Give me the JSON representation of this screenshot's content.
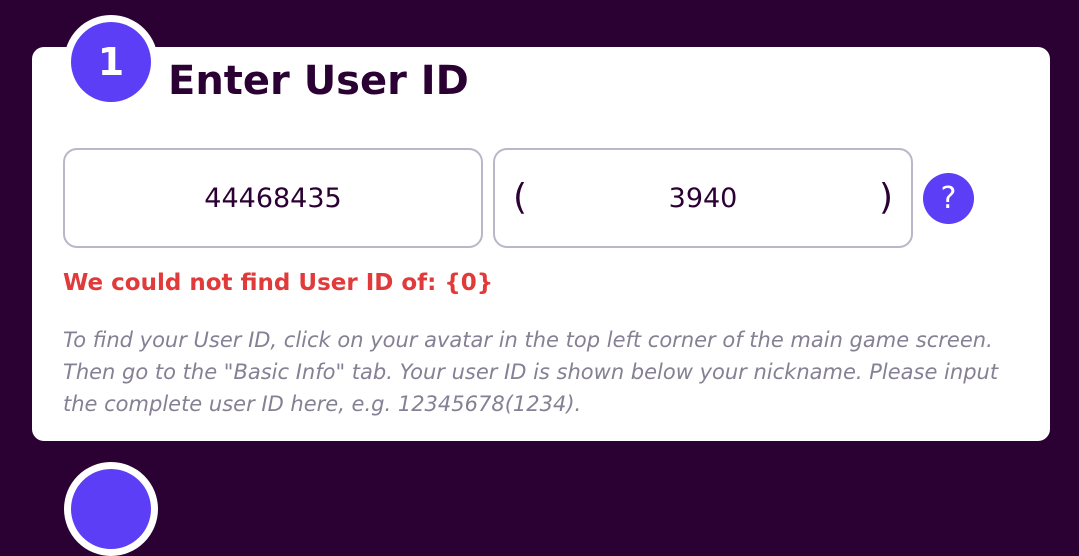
{
  "step": {
    "number": "1",
    "title": "Enter User ID"
  },
  "user_id_input": {
    "value": "44468435"
  },
  "server_input": {
    "open_paren": "(",
    "value": "3940",
    "close_paren": ")"
  },
  "help_button": {
    "label": "?"
  },
  "error": {
    "message": "We could not find User ID of: {0}"
  },
  "instructions": {
    "text": "To find your User ID, click on your avatar in the top left corner of the main game screen. Then go to the \"Basic Info\" tab. Your user ID is shown below your nickname. Please input the complete user ID here, e.g. 12345678(1234)."
  },
  "colors": {
    "background": "#2b0033",
    "accent": "#5b3ef5",
    "error": "#e03a3a"
  }
}
